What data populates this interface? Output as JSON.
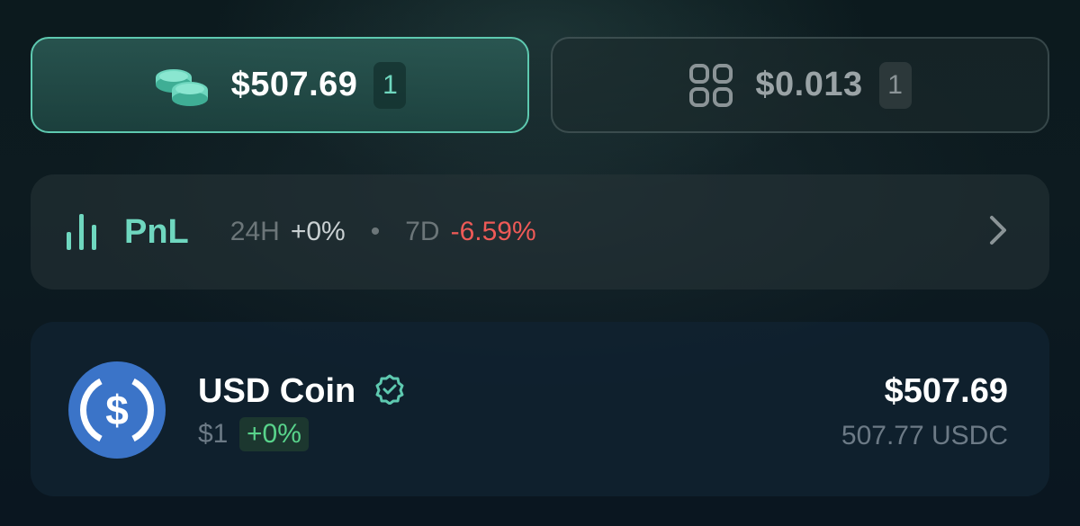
{
  "tabs": {
    "tokens": {
      "amount": "$507.69",
      "count": "1",
      "icon": "coins-icon",
      "active": true,
      "accent": "#5ec9b0"
    },
    "collectibles": {
      "amount": "$0.013",
      "count": "1",
      "icon": "grid-icon",
      "active": false
    }
  },
  "pnl": {
    "label": "PnL",
    "icon": "bar-chart-icon",
    "period_24h": "24H",
    "value_24h": "+0%",
    "separator": "•",
    "period_7d": "7D",
    "value_7d": "-6.59%",
    "negative_color": "#ee5a57",
    "action_icon": "chevron-right-icon"
  },
  "tokens": [
    {
      "name": "USD Coin",
      "verified_icon": "verified-badge-icon",
      "price": "$1",
      "change": "+0%",
      "value": "$507.69",
      "amount": "507.77 USDC",
      "logo_icon": "usdc-logo-icon",
      "logo_color": "#3b74c8"
    }
  ]
}
